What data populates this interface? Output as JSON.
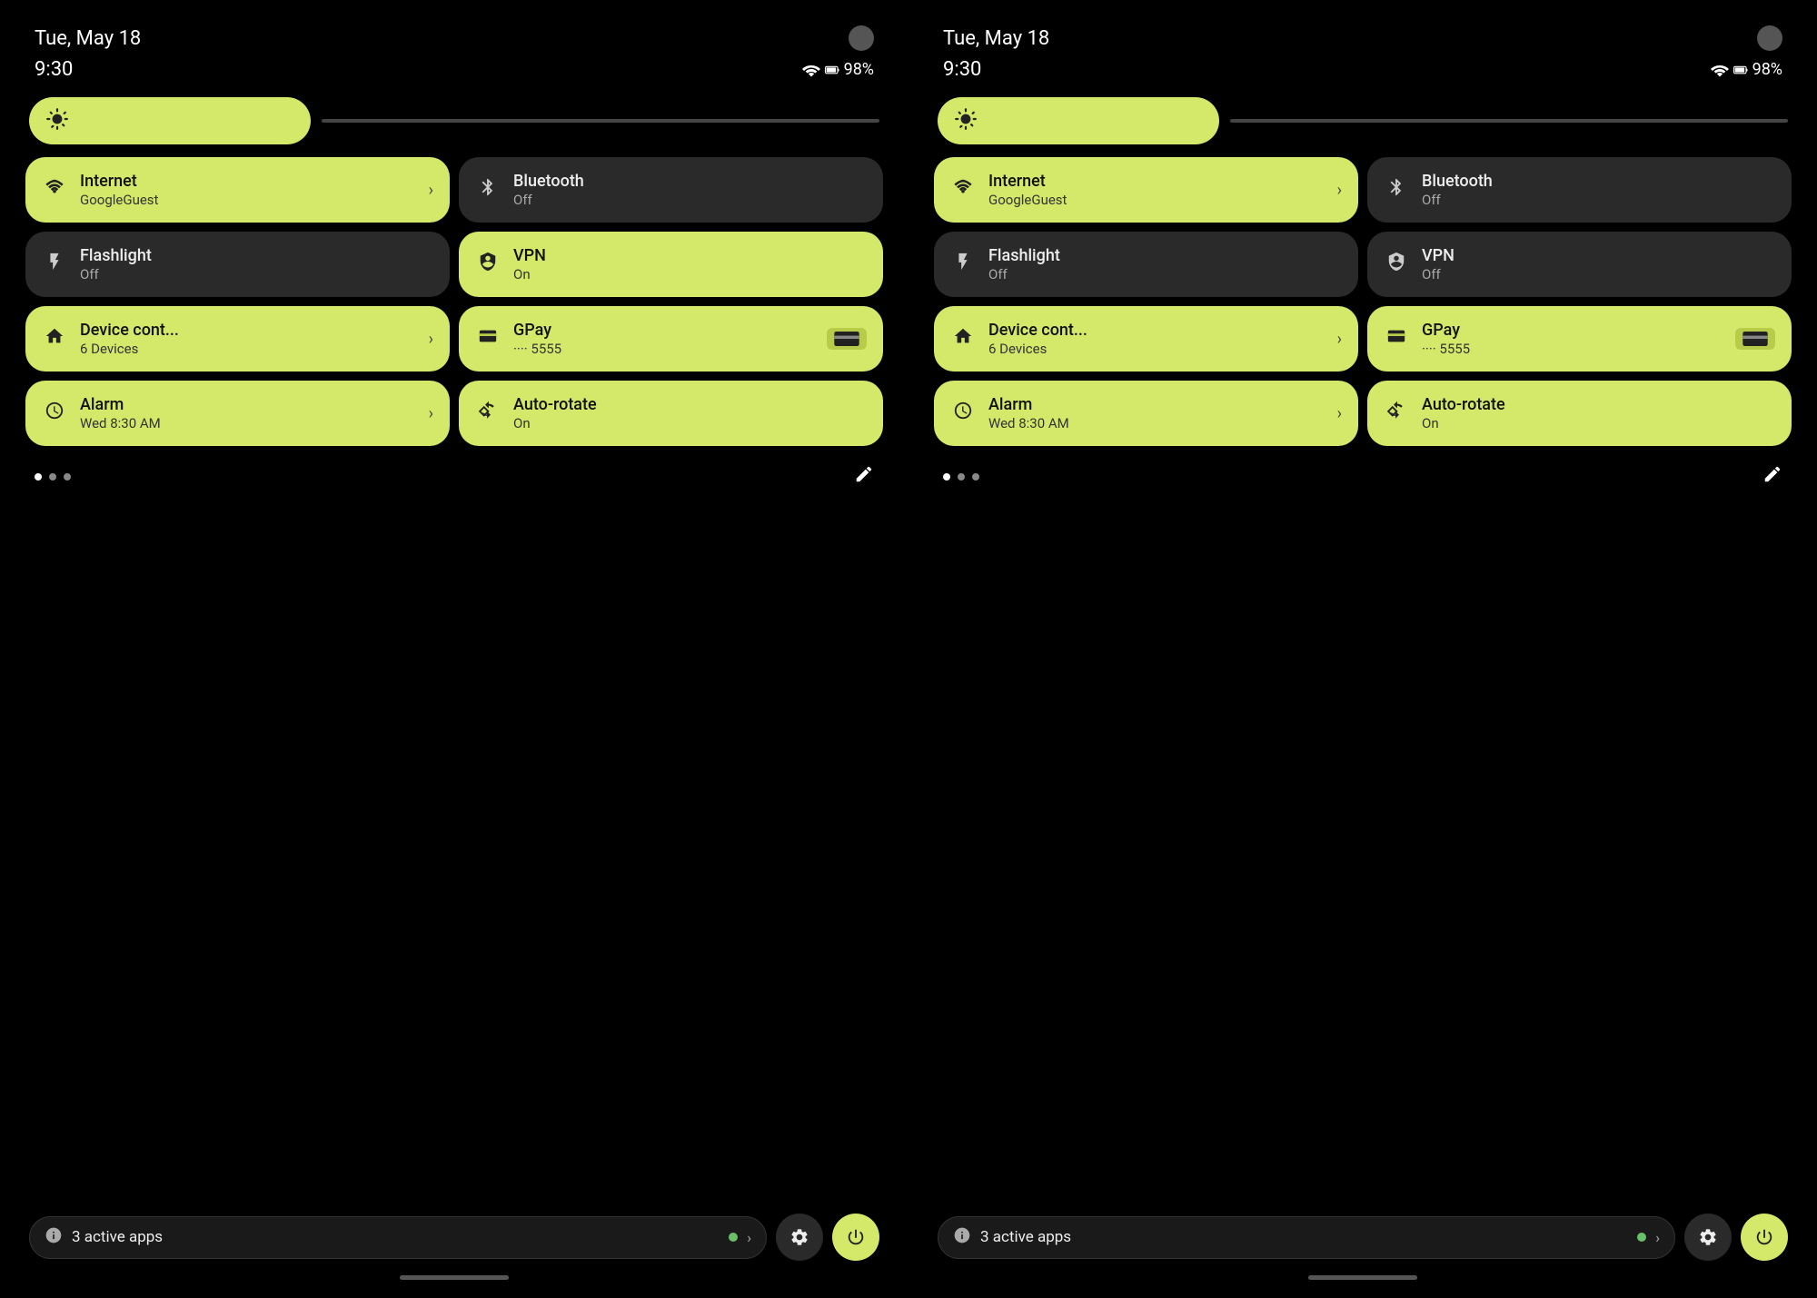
{
  "panels": [
    {
      "id": "left",
      "status": {
        "date": "Tue, May 18",
        "time": "9:30",
        "battery": "98%"
      },
      "brightness": {
        "icon": "⚙",
        "aria": "brightness-control"
      },
      "tiles": [
        {
          "id": "internet",
          "active": true,
          "icon": "wifi",
          "title": "Internet",
          "subtitle": "GoogleGuest",
          "hasChevron": true
        },
        {
          "id": "bluetooth",
          "active": false,
          "icon": "bluetooth",
          "title": "Bluetooth",
          "subtitle": "Off",
          "hasChevron": false
        },
        {
          "id": "flashlight",
          "active": false,
          "icon": "flashlight",
          "title": "Flashlight",
          "subtitle": "Off",
          "hasChevron": false
        },
        {
          "id": "vpn",
          "active": true,
          "icon": "vpn",
          "title": "VPN",
          "subtitle": "On",
          "hasChevron": false
        },
        {
          "id": "device",
          "active": true,
          "icon": "device",
          "title": "Device cont...",
          "subtitle": "6 Devices",
          "hasChevron": true
        },
        {
          "id": "gpay",
          "active": true,
          "icon": "gpay",
          "title": "GPay",
          "subtitle": "···· 5555",
          "hasCard": true
        },
        {
          "id": "alarm",
          "active": true,
          "icon": "alarm",
          "title": "Alarm",
          "subtitle": "Wed 8:30 AM",
          "hasChevron": true
        },
        {
          "id": "autorotate",
          "active": true,
          "icon": "rotate",
          "title": "Auto-rotate",
          "subtitle": "On",
          "hasChevron": false
        }
      ],
      "dots": [
        {
          "active": true
        },
        {
          "active": false
        },
        {
          "active": false
        }
      ],
      "activeApps": {
        "count": "3",
        "label": "active apps"
      }
    },
    {
      "id": "right",
      "status": {
        "date": "Tue, May 18",
        "time": "9:30",
        "battery": "98%"
      },
      "brightness": {
        "icon": "⚙",
        "aria": "brightness-control"
      },
      "tiles": [
        {
          "id": "internet",
          "active": true,
          "icon": "wifi",
          "title": "Internet",
          "subtitle": "GoogleGuest",
          "hasChevron": true
        },
        {
          "id": "bluetooth",
          "active": false,
          "icon": "bluetooth",
          "title": "Bluetooth",
          "subtitle": "Off",
          "hasChevron": false
        },
        {
          "id": "flashlight",
          "active": false,
          "icon": "flashlight",
          "title": "Flashlight",
          "subtitle": "Off",
          "hasChevron": false
        },
        {
          "id": "vpn",
          "active": false,
          "icon": "vpn",
          "title": "VPN",
          "subtitle": "Off",
          "hasChevron": false
        },
        {
          "id": "device",
          "active": true,
          "icon": "device",
          "title": "Device cont...",
          "subtitle": "6 Devices",
          "hasChevron": true
        },
        {
          "id": "gpay",
          "active": true,
          "icon": "gpay",
          "title": "GPay",
          "subtitle": "···· 5555",
          "hasCard": true
        },
        {
          "id": "alarm",
          "active": true,
          "icon": "alarm",
          "title": "Alarm",
          "subtitle": "Wed 8:30 AM",
          "hasChevron": true
        },
        {
          "id": "autorotate",
          "active": true,
          "icon": "rotate",
          "title": "Auto-rotate",
          "subtitle": "On",
          "hasChevron": false
        }
      ],
      "dots": [
        {
          "active": true
        },
        {
          "active": false
        },
        {
          "active": false
        }
      ],
      "activeApps": {
        "count": "3",
        "label": "active apps"
      }
    }
  ],
  "icons": {
    "wifi": "▼",
    "bluetooth": "✱",
    "flashlight": "🔦",
    "vpn": "⊕",
    "device": "⌂",
    "gpay": "▬",
    "alarm": "◷",
    "rotate": "↻",
    "edit": "✎",
    "info": "ⓘ",
    "settings": "⚙",
    "power": "⏻"
  },
  "colors": {
    "active_tile": "#d4e86a",
    "inactive_tile": "#2a2a2a",
    "background": "#000000",
    "text_dark": "#111111",
    "text_light": "#eeeeee"
  }
}
